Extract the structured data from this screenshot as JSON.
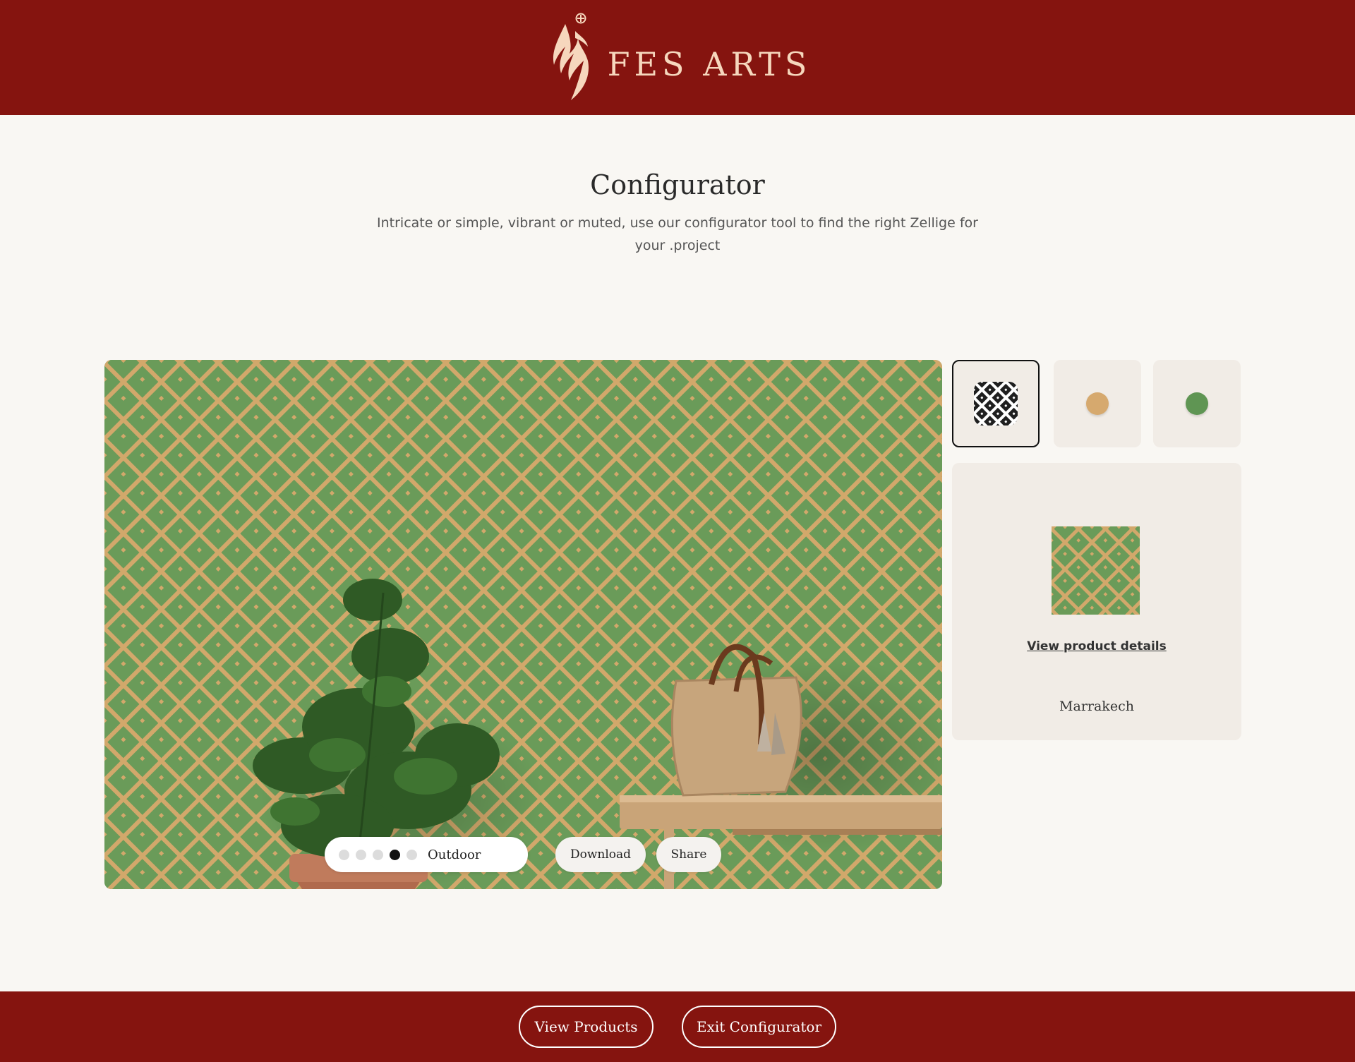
{
  "header": {
    "brand_name": "FES ARTS",
    "logo_icon": "calligraphy-flame-logo",
    "bg_color": "#85140f",
    "brand_color": "#f6d7bd"
  },
  "intro": {
    "title": "Configurator",
    "subtitle": "Intricate or simple, vibrant or muted, use our configurator tool to find the right Zellige for your .project"
  },
  "preview": {
    "scene_dots": [
      {
        "active": false
      },
      {
        "active": false
      },
      {
        "active": false
      },
      {
        "active": true
      },
      {
        "active": false
      }
    ],
    "scene_label": "Outdoor",
    "download_label": "Download",
    "share_label": "Share",
    "pattern_colors": {
      "base": "#6a9b59",
      "lattice": "#d2a86b"
    }
  },
  "options": [
    {
      "type": "pattern",
      "icon": "pattern-icon",
      "selected": true
    },
    {
      "type": "color",
      "color": "#d6a96e",
      "selected": false
    },
    {
      "type": "color",
      "color": "#5f9553",
      "selected": false
    }
  ],
  "details": {
    "link_label": "View product details",
    "product_name": "Marrakech"
  },
  "footer": {
    "view_products_label": "View Products",
    "exit_label": "Exit Configurator"
  }
}
